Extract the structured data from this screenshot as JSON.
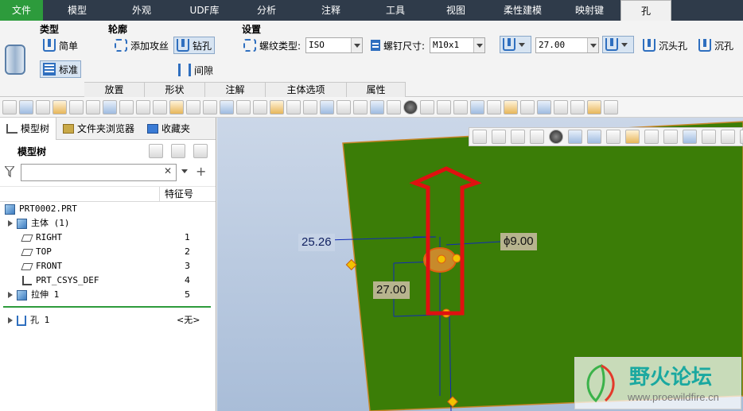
{
  "menu": {
    "tabs": [
      "文件",
      "模型",
      "外观",
      "UDF库",
      "分析",
      "注释",
      "工具",
      "视图",
      "柔性建模",
      "映射键",
      "孔"
    ],
    "active": "孔"
  },
  "ribbon": {
    "type_label": "类型",
    "profile_label": "轮廓",
    "settings_label": "设置",
    "simple_label": "简单",
    "standard_label": "标准",
    "tap_label": "添加攻丝",
    "drill_label": "钻孔",
    "gap_label": "间隙",
    "thread_type_label": "螺纹类型:",
    "thread_type_value": "ISO",
    "screw_size_label": "螺钉尺寸:",
    "screw_size_value": "M10x1",
    "depth_value": "27.00",
    "countersink_label": "沉头孔",
    "counterbore_label": "沉孔",
    "groups": [
      "放置",
      "形状",
      "注解",
      "主体选项",
      "属性"
    ]
  },
  "left_panel": {
    "tabs": [
      "模型树",
      "文件夹浏览器",
      "收藏夹"
    ],
    "tree_title": "模型树",
    "filter_placeholder": "",
    "col_feature_id": "特征号",
    "rows": [
      {
        "name": "PRT0002.PRT",
        "id": ""
      },
      {
        "name": "主体 (1)",
        "id": ""
      },
      {
        "name": "RIGHT",
        "id": "1"
      },
      {
        "name": "TOP",
        "id": "2"
      },
      {
        "name": "FRONT",
        "id": "3"
      },
      {
        "name": "PRT_CSYS_DEF",
        "id": "4"
      },
      {
        "name": "拉伸 1",
        "id": "5"
      },
      {
        "name": "孔 1",
        "id": "<无>"
      }
    ]
  },
  "viewport": {
    "dims": {
      "horizontal": "25.26",
      "diameter": "ϕ9.00",
      "vertical": "27.00"
    },
    "colors": {
      "part_face": "#3b7d07",
      "arrow": "#e01010",
      "dim_line": "#1029b8"
    }
  },
  "watermark": {
    "title": "野火论坛",
    "url": "www.proewildfire.cn"
  }
}
